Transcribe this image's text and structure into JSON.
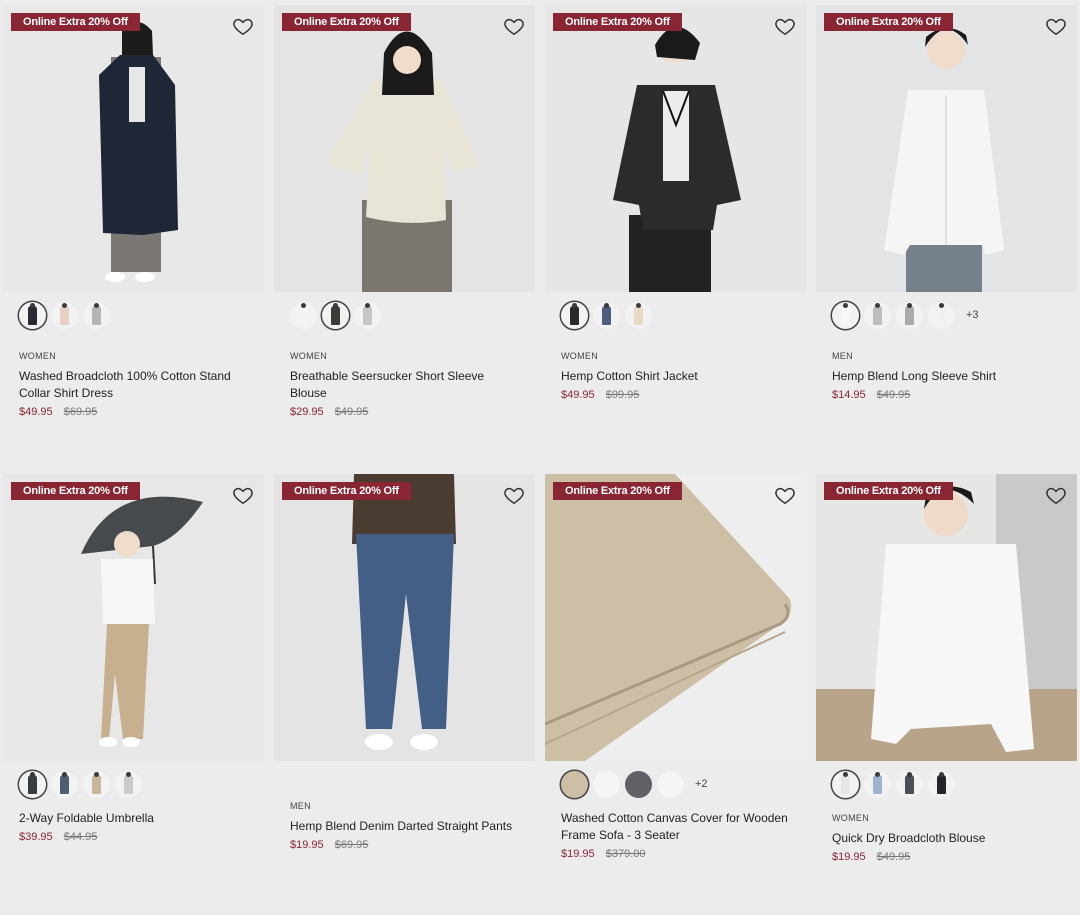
{
  "colors": {
    "accent": "#8a2533",
    "bg": "#ececec"
  },
  "products": [
    {
      "badge": "Online Extra 20% Off",
      "category": "WOMEN",
      "name": "Washed Broadcloth 100% Cotton Stand Collar Shirt Dress",
      "price": "$49.95",
      "was": "$69.95",
      "swatches": [
        {
          "color": "#2a2a33",
          "selected": true
        },
        {
          "color": "#e8cfc4"
        },
        {
          "color": "#b5b5b5"
        }
      ],
      "more": "",
      "icon": "heart-icon"
    },
    {
      "badge": "Online Extra 20% Off",
      "category": "WOMEN",
      "name": "Breathable Seersucker Short Sleeve Blouse",
      "price": "$29.95",
      "was": "$49.95",
      "swatches": [
        {
          "color": "#f4f4f2"
        },
        {
          "color": "#3a3d35",
          "selected": true
        },
        {
          "color": "#c6c6c6"
        }
      ],
      "more": "",
      "icon": "heart-icon"
    },
    {
      "badge": "Online Extra 20% Off",
      "category": "WOMEN",
      "name": "Hemp Cotton Shirt Jacket",
      "price": "$49.95",
      "was": "$99.95",
      "swatches": [
        {
          "color": "#2a2a2a",
          "selected": true
        },
        {
          "color": "#4f5d80"
        },
        {
          "color": "#e6dcc6"
        }
      ],
      "more": "",
      "icon": "heart-icon"
    },
    {
      "badge": "Online Extra 20% Off",
      "category": "MEN",
      "name": "Hemp Blend Long Sleeve Shirt",
      "price": "$14.95",
      "was": "$49.95",
      "swatches": [
        {
          "color": "#f7f7f7",
          "selected": true
        },
        {
          "color": "#bdbdbd"
        },
        {
          "color": "#a9aaac"
        },
        {
          "color": "#f1f1f1"
        }
      ],
      "more": "+3",
      "icon": "heart-icon"
    },
    {
      "badge": "Online Extra 20% Off",
      "category": "",
      "name": "2-Way Foldable Umbrella",
      "price": "$39.95",
      "was": "$44.95",
      "swatches": [
        {
          "color": "#3a3d40",
          "selected": true
        },
        {
          "color": "#4d5e72"
        },
        {
          "color": "#c9b79b"
        },
        {
          "color": "#c8cacc"
        }
      ],
      "more": "",
      "icon": "heart-icon"
    },
    {
      "badge": "Online Extra 20% Off",
      "category": "MEN",
      "name": "Hemp Blend Denim Darted Straight Pants",
      "price": "$19.95",
      "was": "$69.95",
      "swatches": [],
      "more": "",
      "icon": "heart-icon"
    },
    {
      "badge": "Online Extra 20% Off",
      "category": "",
      "name": "Washed Cotton Canvas Cover for Wooden Frame Sofa - 3 Seater",
      "price": "$19.95",
      "was": "$379.00",
      "swatches": [
        {
          "color": "#cdbfa6",
          "selected": true
        },
        {
          "color": "#f5f5f5"
        },
        {
          "color": "#5f6166"
        },
        {
          "color": "#f4f4f4"
        }
      ],
      "more": "+2",
      "icon": "heart-icon"
    },
    {
      "badge": "Online Extra 20% Off",
      "category": "WOMEN",
      "name": "Quick Dry Broadcloth Blouse",
      "price": "$19.95",
      "was": "$49.95",
      "swatches": [
        {
          "color": "#e6e6e6",
          "selected": true
        },
        {
          "color": "#9fb3cf"
        },
        {
          "color": "#4c4f55"
        },
        {
          "color": "#24262b"
        }
      ],
      "more": "",
      "icon": "heart-icon"
    }
  ]
}
